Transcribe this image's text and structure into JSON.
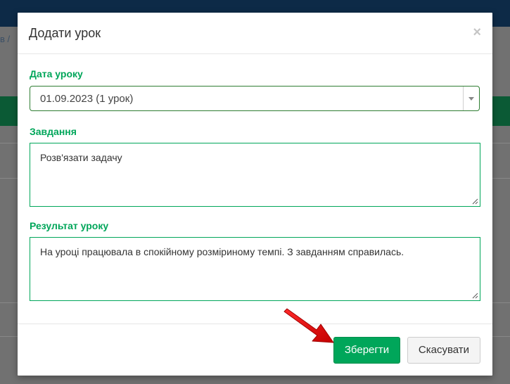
{
  "background": {
    "breadcrumb": "в /"
  },
  "modal": {
    "title": "Додати урок",
    "close_symbol": "×",
    "lesson_date": {
      "label": "Дата уроку",
      "value": "01.09.2023 (1 урок)"
    },
    "task": {
      "label": "Завдання",
      "value": "Розв'язати задачу"
    },
    "result": {
      "label": "Результат уроку",
      "value": "На уроці працювала в спокійному розміриному темпі. З завданням справилась."
    },
    "buttons": {
      "save": "Зберегти",
      "cancel": "Скасувати"
    }
  },
  "colors": {
    "accent": "#00a65a",
    "annotation_arrow": "#e00000"
  }
}
